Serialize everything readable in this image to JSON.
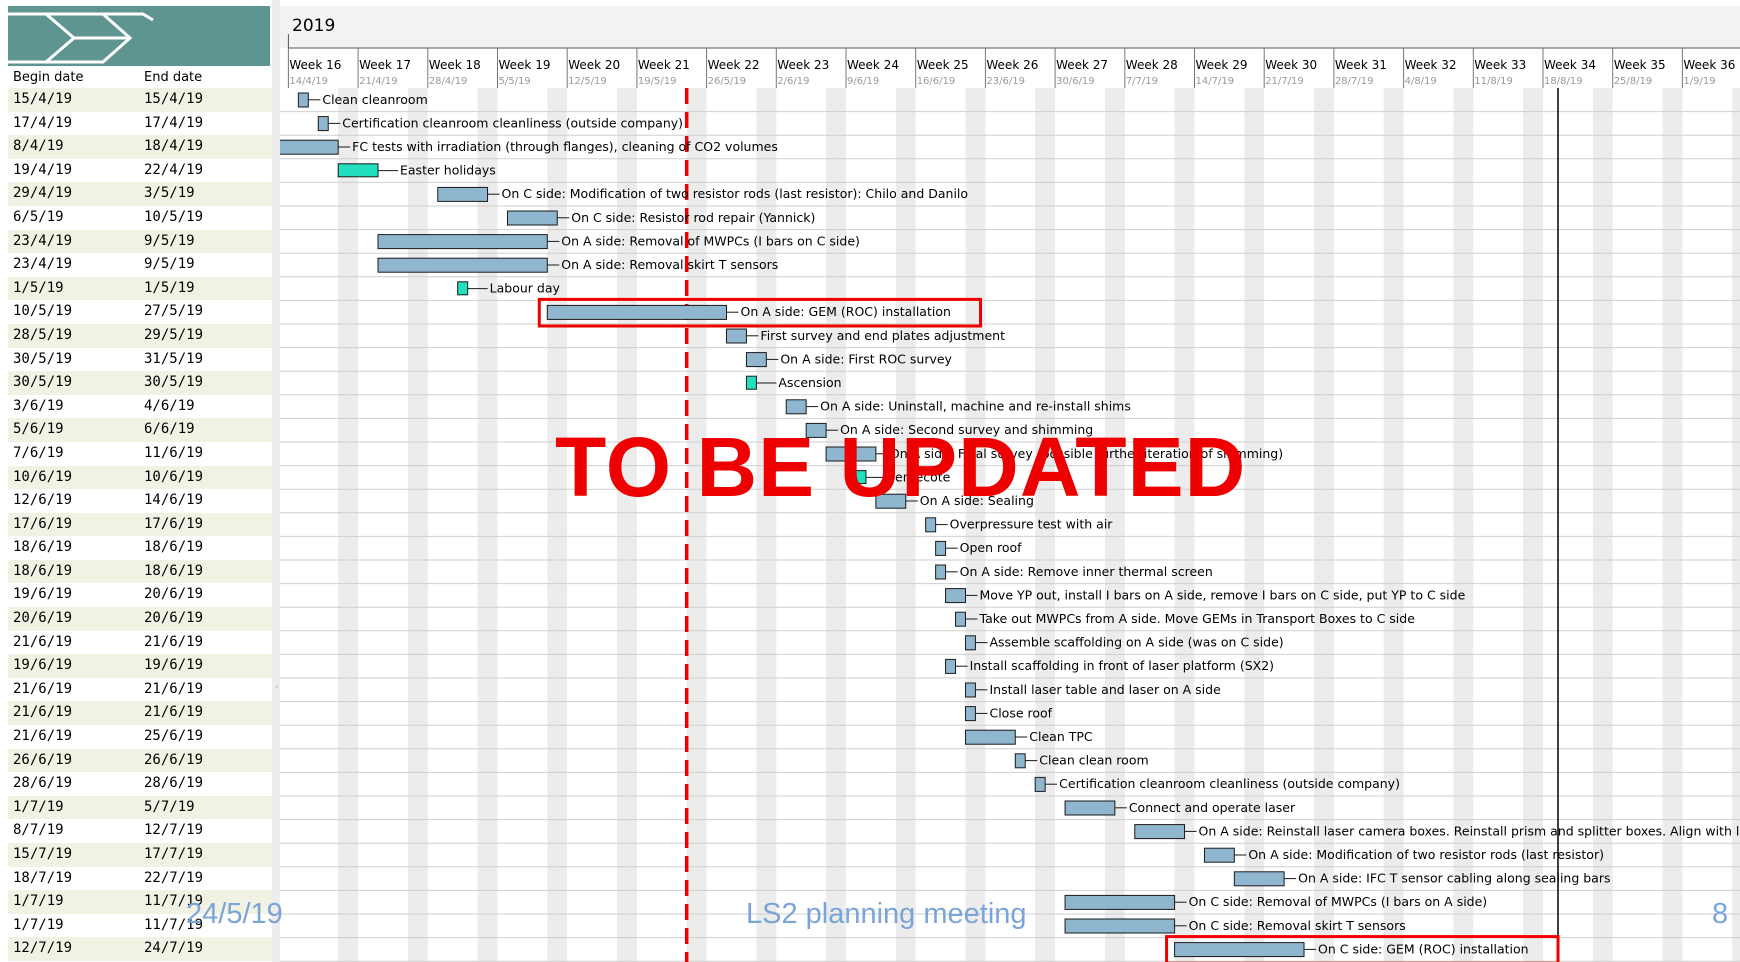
{
  "header": {
    "year": "2019",
    "columns": {
      "begin": "Begin date",
      "end": "End date"
    }
  },
  "weeks": [
    {
      "label": "Week 16",
      "date": "14/4/19"
    },
    {
      "label": "Week 17",
      "date": "21/4/19"
    },
    {
      "label": "Week 18",
      "date": "28/4/19"
    },
    {
      "label": "Week 19",
      "date": "5/5/19"
    },
    {
      "label": "Week 20",
      "date": "12/5/19"
    },
    {
      "label": "Week 21",
      "date": "19/5/19"
    },
    {
      "label": "Week 22",
      "date": "26/5/19"
    },
    {
      "label": "Week 23",
      "date": "2/6/19"
    },
    {
      "label": "Week 24",
      "date": "9/6/19"
    },
    {
      "label": "Week 25",
      "date": "16/6/19"
    },
    {
      "label": "Week 26",
      "date": "23/6/19"
    },
    {
      "label": "Week 27",
      "date": "30/6/19"
    },
    {
      "label": "Week 28",
      "date": "7/7/19"
    },
    {
      "label": "Week 29",
      "date": "14/7/19"
    },
    {
      "label": "Week 30",
      "date": "21/7/19"
    },
    {
      "label": "Week 31",
      "date": "28/7/19"
    },
    {
      "label": "Week 32",
      "date": "4/8/19"
    },
    {
      "label": "Week 33",
      "date": "11/8/19"
    },
    {
      "label": "Week 34",
      "date": "18/8/19"
    },
    {
      "label": "Week 35",
      "date": "25/8/19"
    },
    {
      "label": "Week 36",
      "date": "1/9/19"
    }
  ],
  "colors": {
    "task": "#8fb6cf",
    "milestone": "#21e0bd",
    "highlight": "#ee0000",
    "footer": "#7aa5d8"
  },
  "tasks": [
    {
      "begin": "15/4/19",
      "end": "15/4/19",
      "name": "Clean cleanroom",
      "type": "task"
    },
    {
      "begin": "17/4/19",
      "end": "17/4/19",
      "name": "Certification cleanroom cleanliness (outside company)",
      "type": "task"
    },
    {
      "begin": "8/4/19",
      "end": "18/4/19",
      "name": "FC tests with irradiation (through flanges), cleaning of CO2 volumes",
      "type": "task"
    },
    {
      "begin": "19/4/19",
      "end": "22/4/19",
      "name": "Easter holidays",
      "type": "holiday"
    },
    {
      "begin": "29/4/19",
      "end": "3/5/19",
      "name": "On C side: Modification of two resistor rods (last resistor): Chilo and Danilo",
      "type": "task"
    },
    {
      "begin": "6/5/19",
      "end": "10/5/19",
      "name": "On C side: Resistor rod repair (Yannick)",
      "type": "task"
    },
    {
      "begin": "23/4/19",
      "end": "9/5/19",
      "name": "On A side: Removal of MWPCs (I bars on C side)",
      "type": "task"
    },
    {
      "begin": "23/4/19",
      "end": "9/5/19",
      "name": "On A side: Removal skirt T sensors",
      "type": "task"
    },
    {
      "begin": "1/5/19",
      "end": "1/5/19",
      "name": "Labour day",
      "type": "holiday"
    },
    {
      "begin": "10/5/19",
      "end": "27/5/19",
      "name": "On A side: GEM (ROC) installation",
      "type": "task",
      "highlight": true
    },
    {
      "begin": "28/5/19",
      "end": "29/5/19",
      "name": "First survey and end plates adjustment",
      "type": "task"
    },
    {
      "begin": "30/5/19",
      "end": "31/5/19",
      "name": "On A side: First ROC survey",
      "type": "task"
    },
    {
      "begin": "30/5/19",
      "end": "30/5/19",
      "name": "Ascension",
      "type": "holiday"
    },
    {
      "begin": "3/6/19",
      "end": "4/6/19",
      "name": "On A side: Uninstall, machine and re-install shims",
      "type": "task"
    },
    {
      "begin": "5/6/19",
      "end": "6/6/19",
      "name": "On A side: Second survey and shimming",
      "type": "task"
    },
    {
      "begin": "7/6/19",
      "end": "11/6/19",
      "name": "On A side: Final survey (possible further iteration of shimming)",
      "type": "task"
    },
    {
      "begin": "10/6/19",
      "end": "10/6/19",
      "name": "Pentecote",
      "type": "holiday"
    },
    {
      "begin": "12/6/19",
      "end": "14/6/19",
      "name": "On A side: Sealing",
      "type": "task"
    },
    {
      "begin": "17/6/19",
      "end": "17/6/19",
      "name": "Overpressure test with air",
      "type": "task"
    },
    {
      "begin": "18/6/19",
      "end": "18/6/19",
      "name": "Open roof",
      "type": "task"
    },
    {
      "begin": "18/6/19",
      "end": "18/6/19",
      "name": "On A side: Remove inner thermal screen",
      "type": "task"
    },
    {
      "begin": "19/6/19",
      "end": "20/6/19",
      "name": "Move YP out, install I bars on A side, remove I bars on C side, put YP to C side",
      "type": "task"
    },
    {
      "begin": "20/6/19",
      "end": "20/6/19",
      "name": "Take out MWPCs from A side. Move GEMs in Transport Boxes to C side",
      "type": "task"
    },
    {
      "begin": "21/6/19",
      "end": "21/6/19",
      "name": "Assemble scaffolding on A side (was on C side)",
      "type": "task"
    },
    {
      "begin": "19/6/19",
      "end": "19/6/19",
      "name": "Install scaffolding in front of laser platform (SX2)",
      "type": "task"
    },
    {
      "begin": "21/6/19",
      "end": "21/6/19",
      "name": "Install laser table and laser on A side",
      "type": "task"
    },
    {
      "begin": "21/6/19",
      "end": "21/6/19",
      "name": "Close roof",
      "type": "task"
    },
    {
      "begin": "21/6/19",
      "end": "25/6/19",
      "name": "Clean TPC",
      "type": "task"
    },
    {
      "begin": "26/6/19",
      "end": "26/6/19",
      "name": "Clean clean room",
      "type": "task"
    },
    {
      "begin": "28/6/19",
      "end": "28/6/19",
      "name": "Certification cleanroom cleanliness (outside company)",
      "type": "task"
    },
    {
      "begin": "1/7/19",
      "end": "5/7/19",
      "name": "Connect and operate laser",
      "type": "task"
    },
    {
      "begin": "8/7/19",
      "end": "12/7/19",
      "name": "On A side: Reinstall laser camera boxes. Reinstall prism and splitter boxes. Align with laser",
      "type": "task"
    },
    {
      "begin": "15/7/19",
      "end": "17/7/19",
      "name": "On A side: Modification of two resistor rods (last resistor)",
      "type": "task"
    },
    {
      "begin": "18/7/19",
      "end": "22/7/19",
      "name": "On A side: IFC T sensor cabling along sealing bars",
      "type": "task"
    },
    {
      "begin": "1/7/19",
      "end": "11/7/19",
      "name": "On C side: Removal of MWPCs (I bars on A side)",
      "type": "task"
    },
    {
      "begin": "1/7/19",
      "end": "11/7/19",
      "name": "On C side: Removal skirt T sensors",
      "type": "task"
    },
    {
      "begin": "12/7/19",
      "end": "24/7/19",
      "name": "On C side: GEM (ROC) installation",
      "type": "task",
      "highlight": true
    }
  ],
  "overlay": {
    "stamp": "TO BE UPDATED"
  },
  "footer": {
    "date": "24/5/19",
    "title": "LS2 planning meeting",
    "page": "8"
  }
}
